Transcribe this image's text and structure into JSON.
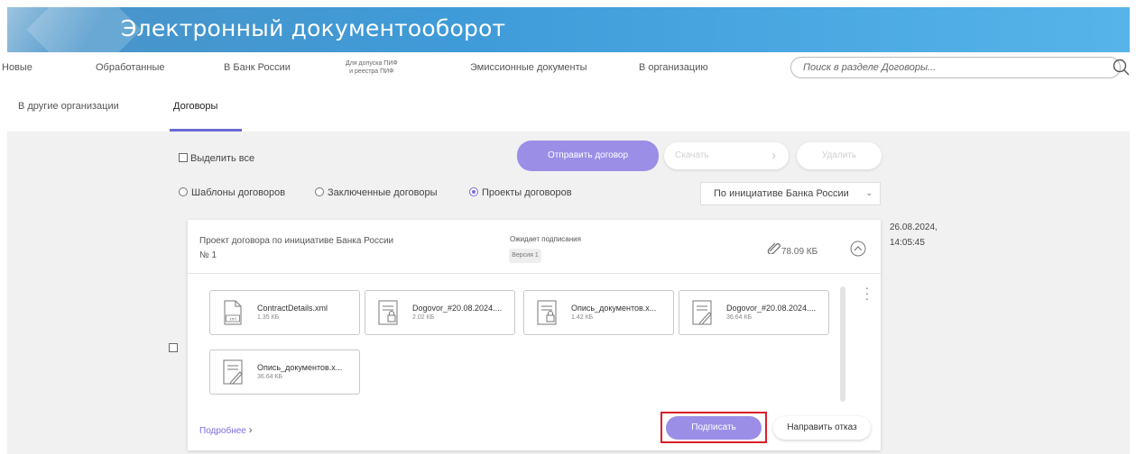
{
  "header": {
    "title": "Электронный документооборот"
  },
  "tabs": {
    "row1": [
      {
        "label": "Новые"
      },
      {
        "label": "Обработанные"
      },
      {
        "label": "В Банк России"
      },
      {
        "label_line1": "Для допуска ПИФ",
        "label_line2": "и реестра ПИФ"
      },
      {
        "label": "Эмиссионные документы"
      },
      {
        "label": "В организацию"
      }
    ],
    "row2": [
      {
        "label": "В другие организации"
      },
      {
        "label": "Договоры",
        "active": true
      }
    ]
  },
  "search": {
    "placeholder": "Поиск в разделе Договоры..."
  },
  "toolbar": {
    "select_all": "Выделить все",
    "send_contract": "Отправить договор",
    "download": "Скачать",
    "delete": "Удалить",
    "download_arrow": "›"
  },
  "filters": {
    "radios": [
      {
        "label": "Шаблоны договоров",
        "checked": false
      },
      {
        "label": "Заключенные договоры",
        "checked": false
      },
      {
        "label": "Проекты договоров",
        "checked": true
      }
    ],
    "initiative_select": "По инициативе Банка России"
  },
  "card": {
    "title": "Проект договора по инициативе Банка России",
    "number": "№ 1",
    "status": "Ожидает подписания",
    "version": "Версия 1",
    "size": "78.09 КБ",
    "date": "26.08.2024,",
    "time": "14:05:45",
    "files": [
      {
        "name": "ContractDetails.xml",
        "size": "1.35 КБ",
        "icon": "xml-file-icon"
      },
      {
        "name": "Dogovor_#20.08.2024....",
        "size": "2.02 КБ",
        "icon": "locked-file-icon"
      },
      {
        "name": "Опись_документов.х...",
        "size": "1.42 КБ",
        "icon": "locked-file-icon"
      },
      {
        "name": "Dogovor_#20.08.2024....",
        "size": "36.64 КБ",
        "icon": "signed-file-icon"
      },
      {
        "name": "Опись_документов.х...",
        "size": "36.64 КБ",
        "icon": "signed-file-icon"
      }
    ],
    "more_link": "Подробнее",
    "sign_button": "Подписать",
    "reject_button": "Направить отказ"
  },
  "colors": {
    "banner": "#3f9bd8",
    "accent": "#9a8ee6",
    "highlight": "#d8202a",
    "panel": "#f1f1f1"
  }
}
